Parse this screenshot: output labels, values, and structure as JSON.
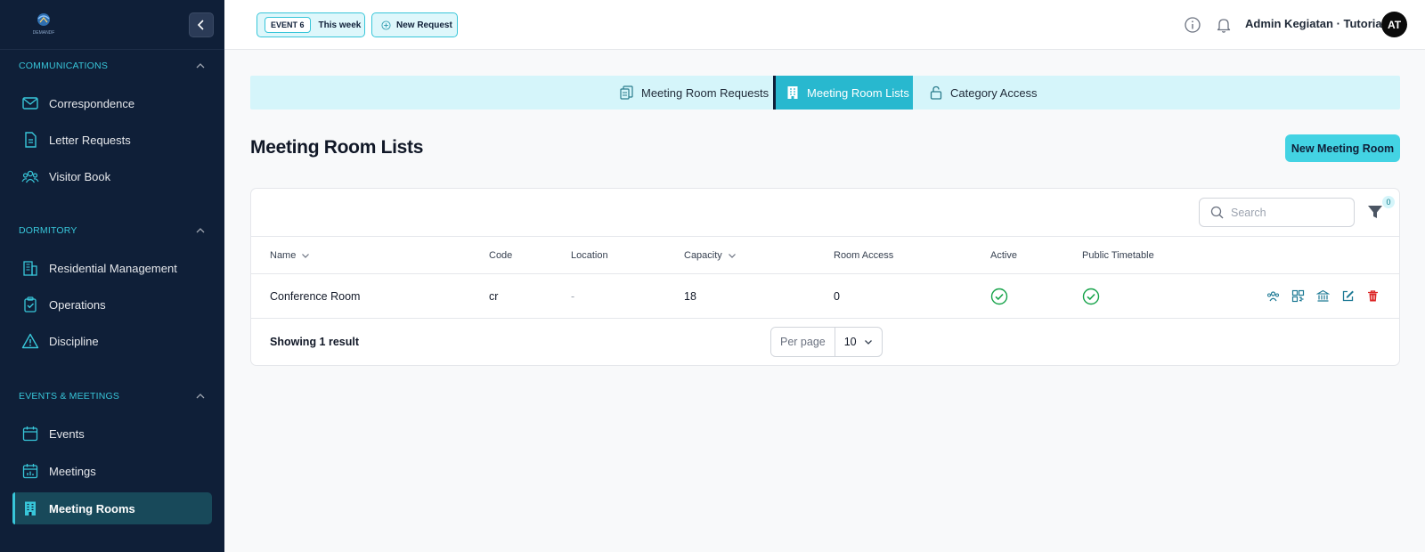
{
  "header": {
    "event_tag": "EVENT 6",
    "event_range": "This week",
    "new_request": "New Request",
    "user_name": "Admin Kegiatan · Tutorial",
    "avatar_initials": "AT"
  },
  "sidebar": {
    "logo_text": "DEMANDF",
    "sections": [
      {
        "title": "COMMUNICATIONS",
        "items": [
          {
            "label": "Correspondence",
            "icon": "mail-icon"
          },
          {
            "label": "Letter Requests",
            "icon": "document-icon"
          },
          {
            "label": "Visitor Book",
            "icon": "users-icon"
          }
        ]
      },
      {
        "title": "DORMITORY",
        "items": [
          {
            "label": "Residential Management",
            "icon": "building-icon"
          },
          {
            "label": "Operations",
            "icon": "clipboard-check-icon"
          },
          {
            "label": "Discipline",
            "icon": "warning-icon"
          }
        ]
      },
      {
        "title": "EVENTS & MEETINGS",
        "items": [
          {
            "label": "Events",
            "icon": "calendar-icon"
          },
          {
            "label": "Meetings",
            "icon": "calendar-chart-icon"
          },
          {
            "label": "Meeting Rooms",
            "icon": "office-building-icon",
            "active": true
          }
        ]
      }
    ]
  },
  "tabs": [
    {
      "label": "Meeting Room Requests",
      "active": false
    },
    {
      "label": "Meeting Room Lists",
      "active": true
    },
    {
      "label": "Category Access",
      "active": false
    }
  ],
  "page": {
    "title": "Meeting Room Lists",
    "primary_action": "New Meeting Room"
  },
  "table": {
    "search_placeholder": "Search",
    "filter_count": "0",
    "columns": [
      "Name",
      "Code",
      "Location",
      "Capacity",
      "Room Access",
      "Active",
      "Public Timetable"
    ],
    "rows": [
      {
        "name": "Conference Room",
        "code": "cr",
        "location": "-",
        "capacity": "18",
        "room_access": "0",
        "active": true,
        "public_timetable": true
      }
    ],
    "footer_text": "Showing 1 result",
    "per_page_label": "Per page",
    "per_page_value": "10"
  },
  "colors": {
    "sidebar_bg": "#0f1f38",
    "accent": "#38c6d9",
    "tab_active": "#28b8cf",
    "success": "#16a34a",
    "danger": "#dc2626"
  }
}
